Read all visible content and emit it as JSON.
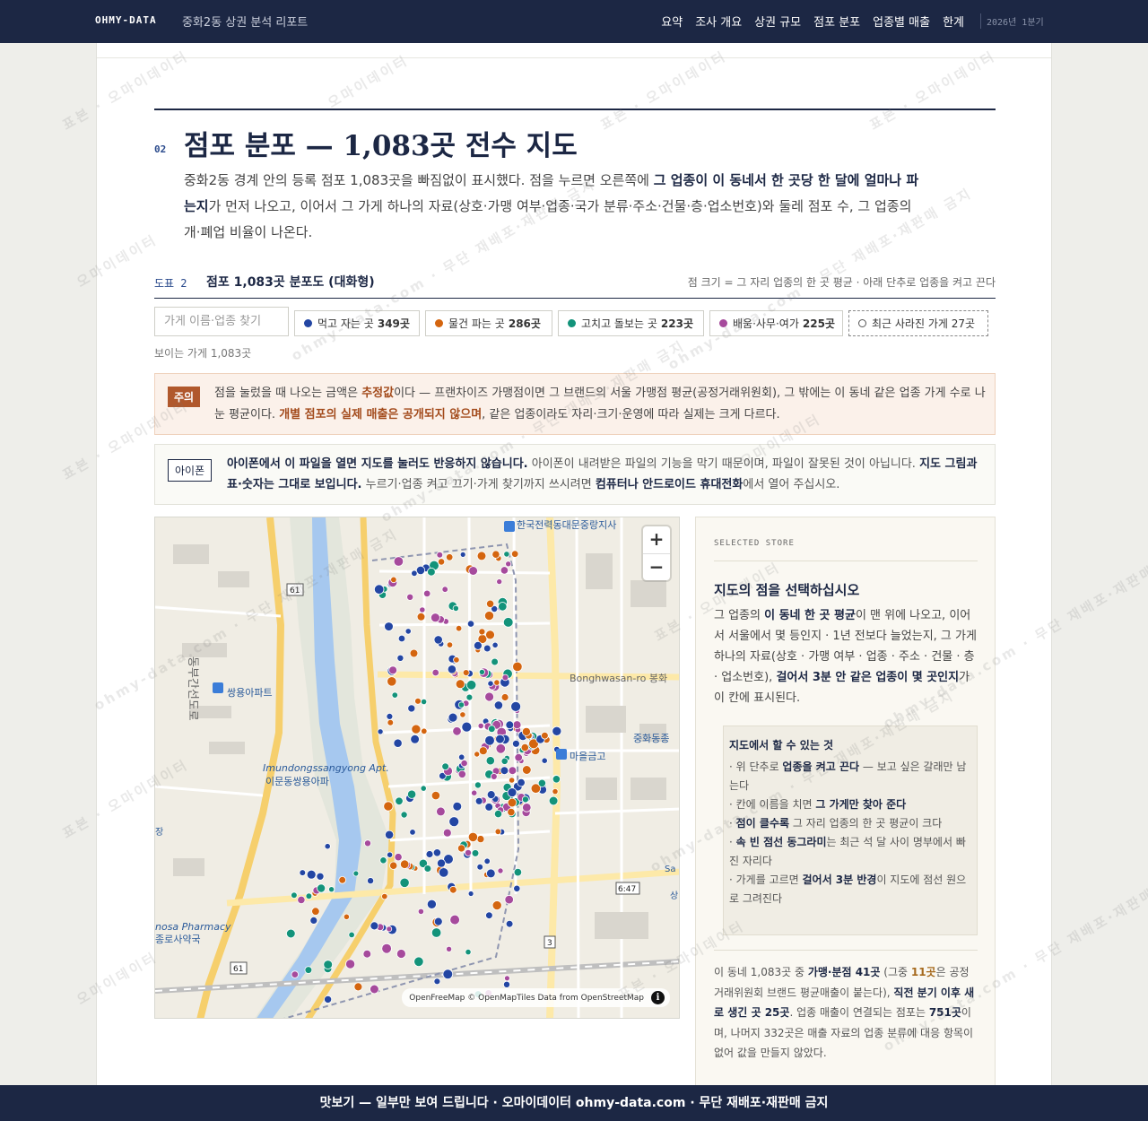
{
  "nav": {
    "brand": "OHMY-DATA",
    "report_title": "중화2동 상권 분석 리포트",
    "links": [
      "요약",
      "조사 개요",
      "상권 규모",
      "점포 분포",
      "업종별 매출",
      "한계"
    ],
    "date": "2026년 1분기"
  },
  "section": {
    "number": "02",
    "title": "점포 분포 — 1,083곳 전수 지도",
    "lead_1": "중화2동 경계 안의 등록 점포 1,083곳을 빠짐없이 표시했다. 점을 누르면 오른쪽에 ",
    "lead_b1": "그 업종이 이 동네서 한 곳당 한 달에 얼마나 파는지",
    "lead_2": "가 먼저 나오고, 이어서 그 가게 하나의 자료(상호·가맹 여부·업종·국가 분류·주소·건물·층·업소번호)와 둘레 점포 수, 그 업종의 개·폐업 비율이 나온다."
  },
  "figure": {
    "label": "도표 2",
    "title": "점포 1,083곳 분포도 (대화형)",
    "note": "점 크기 = 그 자리 업종의 한 곳 평균 · 아래 단추로 업종을 켜고 끈다"
  },
  "controls": {
    "search_placeholder": "가게 이름·업종 찾기",
    "filters": [
      {
        "label": "먹고 자는 곳",
        "count": "349곳",
        "color": "#2346a3"
      },
      {
        "label": "물건 파는 곳",
        "count": "286곳",
        "color": "#d4650f"
      },
      {
        "label": "고치고 돌보는 곳",
        "count": "223곳",
        "color": "#13937a"
      },
      {
        "label": "배움·사무·여가",
        "count": "225곳",
        "color": "#a64a9c"
      }
    ],
    "closed_filter": "최근 사라진 가게 27곳",
    "visible_count": "보이는 가게 1,083곳"
  },
  "caution": {
    "tag": "주의",
    "t1": "점을 눌렀을 때 나오는 금액은 ",
    "h1": "추정값",
    "t2": "이다 — 프랜차이즈 가맹점이면 그 브랜드의 서울 가맹점 평균(공정거래위원회), 그 밖에는 이 동네 같은 업종 가게 수로 나눈 평균이다. ",
    "h2": "개별 점포의 실제 매출은 공개되지 않으며",
    "t3": ", 같은 업종이라도 자리·크기·운영에 따라 실제는 크게 다르다."
  },
  "iphone": {
    "tag": "아이폰",
    "b1": "아이폰에서 이 파일을 열면 지도를 눌러도 반응하지 않습니다.",
    "t1": " 아이폰이 내려받은 파일의 기능을 막기 때문이며, 파일이 잘못된 것이 아닙니다. ",
    "b2": "지도 그림과 표·숫자는 그대로 보입니다.",
    "t2": " 누르기·업종 켜고 끄기·가게 찾기까지 쓰시려면 ",
    "b3": "컴퓨터나 안드로이드 휴대전화",
    "t3": "에서 열어 주십시오."
  },
  "map": {
    "labels": {
      "kepco": "한국전력동대문중랑지사",
      "ssangyong_ko": "쌍용아파트",
      "apt_en": "Imundongssangyong Apt.",
      "apt_ko": "이문동쌍용아파",
      "road": "Bonghwasan-ro 봉화",
      "junghwa": "중화동종",
      "maeul": "마을금고",
      "pharmacy_en": "nosa Pharmacy",
      "pharmacy_ko": "종로사약국",
      "expressway": "동부간선도로",
      "route61a": "61",
      "route61b": "61",
      "route3": "3",
      "exit647": "6:47",
      "sa": "Sa",
      "ji": "장",
      "sang": "상"
    },
    "zoom_in": "+",
    "zoom_out": "−",
    "attribution": "OpenFreeMap © OpenMapTiles Data from OpenStreetMap",
    "info_icon": "i"
  },
  "panel": {
    "kicker": "SELECTED STORE",
    "title": "지도의 점을 선택하십시오",
    "body_1": "그 업종의 ",
    "body_b1": "이 동네 한 곳 평균",
    "body_2": "이 맨 위에 나오고, 이어서 서울에서 몇 등인지 · 1년 전보다 늘었는지, 그 가게 하나의 자료(상호 · 가맹 여부 · 업종 · 주소 · 건물 · 층 · 업소번호), ",
    "body_b2": "걸어서 3분 안 같은 업종이 몇 곳인지",
    "body_3": "가 이 칸에 표시된다.",
    "help_title": "지도에서 할 수 있는 것",
    "help_1a": "· 위 단추로 ",
    "help_1b": "업종을 켜고 끈다",
    "help_1c": " — 보고 싶은 갈래만 남는다",
    "help_2a": "· 칸에 이름을 치면 ",
    "help_2b": "그 가게만 찾아 준다",
    "help_3a": "· ",
    "help_3b": "점이 클수록",
    "help_3c": " 그 자리 업종의 한 곳 평균이 크다",
    "help_4a": "· ",
    "help_4b": "속 빈 점선 동그라미",
    "help_4c": "는 최근 석 달 사이 명부에서 빠진 자리다",
    "help_5a": "· 가게를 고르면 ",
    "help_5b": "걸어서 3분 반경",
    "help_5c": "이 지도에 점선 원으로 그려진다",
    "foot_1": "이 동네 1,083곳 중 ",
    "foot_b1": "가맹·분점 41곳",
    "foot_2": " (그중 ",
    "foot_g": "11곳",
    "foot_3": "은 공정거래위원회 브랜드 평균매출이 붙는다), ",
    "foot_b2": "직전 분기 이후 새로 생긴 곳 25곳",
    "foot_4": ". 업종 매출이 연결되는 점포는 ",
    "foot_b3": "751곳",
    "foot_5": "이며, 나머지 332곳은 매출 자료의 업종 분류에 대응 항목이 없어 값을 만들지 않았다."
  },
  "footer": {
    "text": "맛보기 — 일부만 보여 드립니다 · 오마이데이터 ohmy-data.com · 무단 재배포·재판매 금지"
  },
  "watermark": {
    "a": "표본 · 오마이데이터",
    "b": "ohmy-data.com · 무단 재배포·재판매 금지",
    "c": "오마이데이터"
  },
  "colors": {
    "navy": "#1c2744",
    "eat": "#2346a3",
    "shop": "#d4650f",
    "care": "#13937a",
    "office": "#a64a9c",
    "caution": "#b0582c"
  }
}
